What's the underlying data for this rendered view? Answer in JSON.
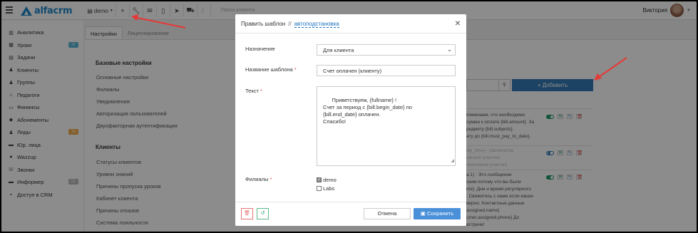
{
  "topbar": {
    "logo_text": "alfacrm",
    "branch_label": "demo",
    "search_placeholder": "Поиск клиента",
    "user_name": "Виктория"
  },
  "sidebar": {
    "items": [
      {
        "label": "Аналитика",
        "icon": "bar-chart-icon"
      },
      {
        "label": "Уроки",
        "icon": "calendar-icon",
        "badge": "0",
        "badge_color": "#5cb8d6"
      },
      {
        "label": "Задачи",
        "icon": "tasks-icon"
      },
      {
        "label": "Клиенты",
        "icon": "user-icon"
      },
      {
        "label": "Группы",
        "icon": "users-icon"
      },
      {
        "label": "Педагоги",
        "icon": "graduation-cap-icon"
      },
      {
        "label": "Финансы",
        "icon": "money-icon"
      },
      {
        "label": "Абонементы",
        "icon": "tag-icon"
      },
      {
        "label": "Лиды",
        "icon": "lead-icon",
        "badge": "10",
        "badge_color": "#f0ad4e"
      },
      {
        "label": "Юр. лица",
        "icon": "briefcase-icon"
      },
      {
        "label": "Wazzup",
        "icon": "chat-icon"
      },
      {
        "label": "Звонки",
        "icon": "phone-icon"
      },
      {
        "label": "Информер",
        "icon": "inbox-icon",
        "badge": "21",
        "badge_color": "#bbbbbb"
      },
      {
        "label": "Доступ в CRM",
        "icon": "lock-icon"
      }
    ]
  },
  "tabs": [
    "Настройки",
    "Лицензирование"
  ],
  "settings": {
    "section1_title": "Базовые настройки",
    "section1_links": [
      "Основные настройки",
      "Филиалы",
      "Уведомления",
      "Авторизация пользователей",
      "Двухфакторная аутентификация"
    ],
    "section2_title": "Клиенты",
    "section2_links": [
      "Статусы клиентов",
      "Уровни знаний",
      "Причины пропуска уроков",
      "Кабинет клиента",
      "Причины отказов",
      "Система лояльности"
    ]
  },
  "background_list": {
    "add_button": "+ Добавить",
    "rows": [
      [
        "поминаем, что необходимо",
        "сумма к оплате {bill.amount}. За",
        "редмету {bill.subjects}.",
        "ату до {bill.must_pay_to_date}."
      ],
      [
        "lay_time} - распечатка",
        "начало участия",
        "окончание участия"
      ],
      [
        "а.1) : Это сообщение",
        "ским потому что вы были",
        "me}. Дни и время регулярного",
        ". Свяжитесь с нами если какая-",
        "верно. Контактные данные",
        "assigned.name}",
        "umer.assigned.phone} До",
        "встречи!"
      ]
    ]
  },
  "modal": {
    "title": "Править шаблон",
    "separator": "//",
    "subtitle": "автоподстановка",
    "close": "×",
    "purpose_label": "Назначение",
    "purpose_value": "Для клиента",
    "name_label": "Название шаблона",
    "name_value": "Счет оплачен (клиенту)",
    "text_label": "Текст",
    "text_value": "Приветствуем, {fullname} !\nСчет за период с {bill.begin_date} по\n{bill.end_date} оплачен.\nСпасибо!",
    "branches_label": "Филиалы",
    "branches": [
      {
        "label": "demo",
        "checked": true
      },
      {
        "label": "Labs",
        "checked": false
      }
    ],
    "required_mark": "*",
    "cancel_label": "Отмена",
    "save_label": "Сохранить"
  }
}
